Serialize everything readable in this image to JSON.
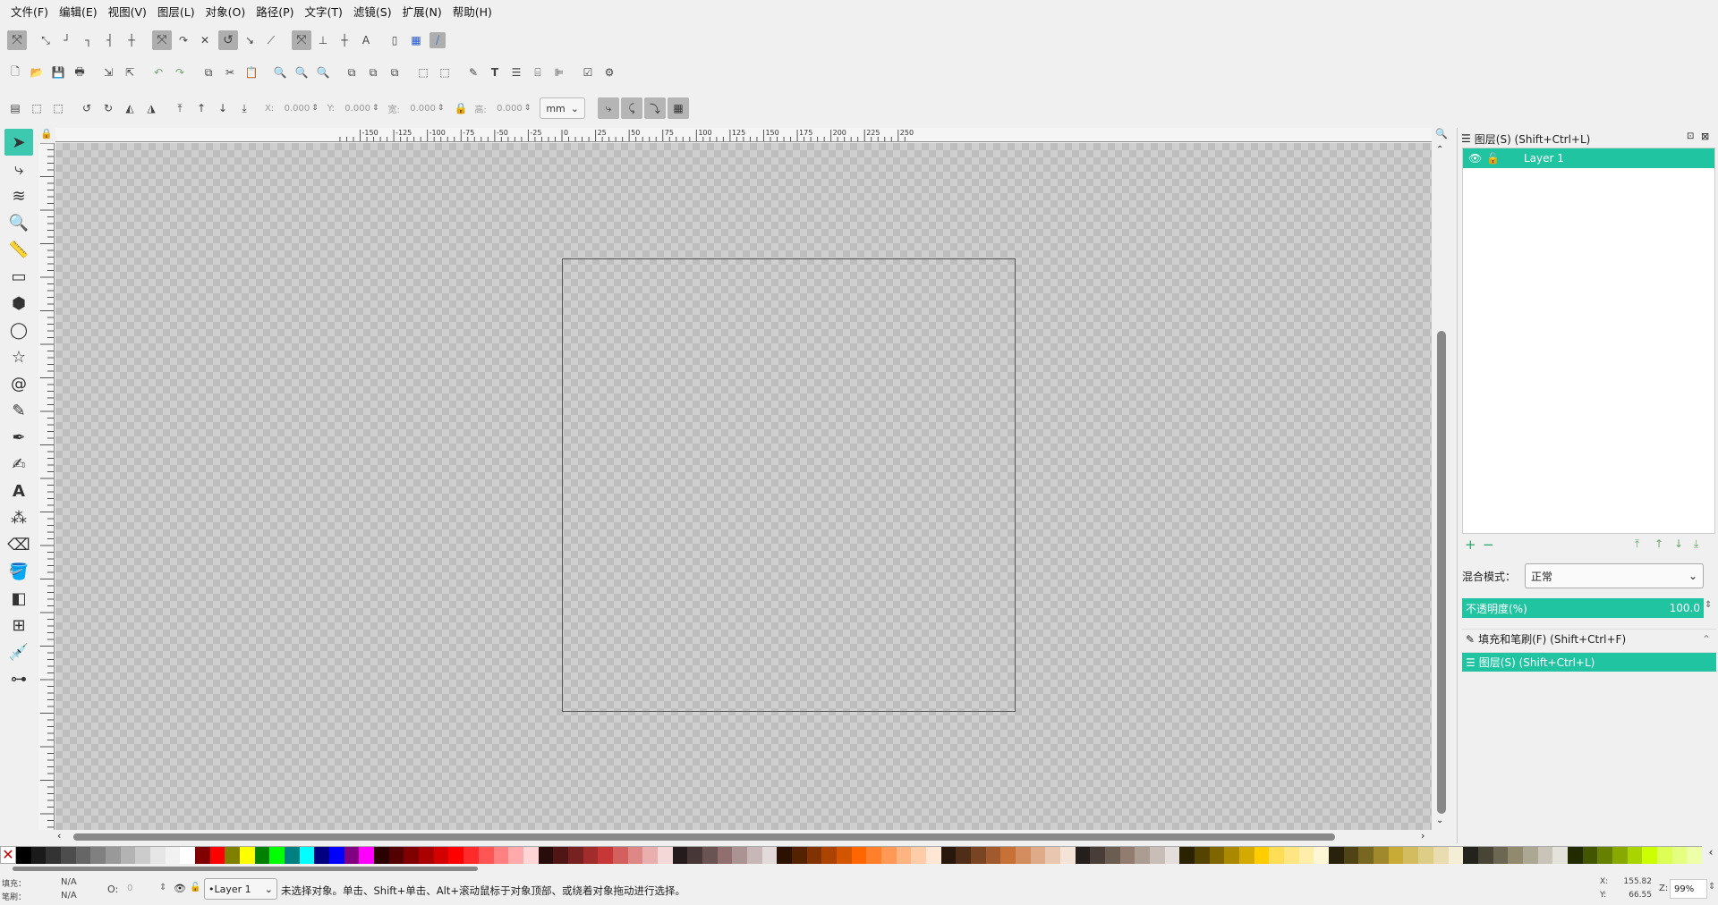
{
  "menu": [
    "文件(F)",
    "编辑(E)",
    "视图(V)",
    "图层(L)",
    "对象(O)",
    "路径(P)",
    "文字(T)",
    "滤镜(S)",
    "扩展(N)",
    "帮助(H)"
  ],
  "toolbar3": {
    "x_label": "X:",
    "x_value": "0.000",
    "y_label": "Y:",
    "y_value": "0.000",
    "w_label": "宽:",
    "w_value": "0.000",
    "h_label": "高:",
    "h_value": "0.000",
    "unit": "mm"
  },
  "hruler_ticks": [
    "-150",
    "-125",
    "-100",
    "-75",
    "-50",
    "-25",
    "0",
    "25",
    "50",
    "75",
    "100",
    "125",
    "150",
    "175",
    "200",
    "225",
    "250"
  ],
  "layers_panel": {
    "title": "图层(S) (Shift+Ctrl+L)",
    "layer_name": "Layer 1",
    "blend_label": "混合模式：",
    "blend_value": "正常",
    "opacity_label": "不透明度(%)",
    "opacity_value": "100.0",
    "dock_fill": "填充和笔刷(F) (Shift+Ctrl+F)",
    "dock_layers": "图层(S) (Shift+Ctrl+L)"
  },
  "status": {
    "fill_label": "填充：",
    "fill_value": "N/A",
    "stroke_label": "笔刷：",
    "stroke_value": "N/A",
    "o_label": "O:",
    "o_value": "0",
    "current_layer": "•Layer 1",
    "message": "未选择对象。单击、Shift+单击、Alt+滚动鼠标于对象顶部、或绕着对象拖动进行选择。",
    "cx_label": "X:",
    "cx_value": "155.82",
    "cy_label": "Y:",
    "cy_value": "66.55",
    "zoom_label": "Z:",
    "zoom_value": "99%"
  },
  "palette": [
    "#000000",
    "#1a1a1a",
    "#333333",
    "#4d4d4d",
    "#666666",
    "#808080",
    "#999999",
    "#b3b3b3",
    "#cccccc",
    "#e6e6e6",
    "#f2f2f2",
    "#ffffff",
    "#800000",
    "#ff0000",
    "#808000",
    "#ffff00",
    "#008000",
    "#00ff00",
    "#008080",
    "#00ffff",
    "#000080",
    "#0000ff",
    "#800080",
    "#ff00ff",
    "#2b0000",
    "#550000",
    "#800000",
    "#aa0000",
    "#d40000",
    "#ff0000",
    "#ff2a2a",
    "#ff5555",
    "#ff8080",
    "#ffaaaa",
    "#ffd5d5",
    "#280b0b",
    "#501616",
    "#782121",
    "#a02c2c",
    "#c83737",
    "#d35f5f",
    "#de8787",
    "#e9afaf",
    "#f4d7d7",
    "#241c1c",
    "#483737",
    "#6c5353",
    "#916f6f",
    "#ac9393",
    "#c8b7b7",
    "#e3dbdb",
    "#2b1100",
    "#552200",
    "#803300",
    "#aa4400",
    "#d45500",
    "#ff6600",
    "#ff7f2a",
    "#ff9955",
    "#ffb380",
    "#ffccaa",
    "#ffe6d5",
    "#28170b",
    "#502d16",
    "#784421",
    "#a05a2c",
    "#c87137",
    "#d38d5f",
    "#deaa87",
    "#e9c6af",
    "#f4e3d7",
    "#241f1c",
    "#483e37",
    "#6c5d53",
    "#917c6f",
    "#ac9d93",
    "#c8beb7",
    "#e3dedb",
    "#2b2200",
    "#554400",
    "#806600",
    "#aa8800",
    "#d4aa00",
    "#ffcc00",
    "#ffdd55",
    "#ffe680",
    "#ffeeaa",
    "#fff6d5",
    "#28220b",
    "#504416",
    "#786721",
    "#a0892c",
    "#c8ab37",
    "#d3bc5f",
    "#decd87",
    "#e9ddaf",
    "#f4eed7",
    "#24221c",
    "#484537",
    "#6c6753",
    "#918a6f",
    "#aca793",
    "#c8c4b7",
    "#e3e2db",
    "#222b00",
    "#445500",
    "#668000",
    "#88aa00",
    "#aad400",
    "#ccff00",
    "#ddff55",
    "#e5ff80",
    "#eeffaa"
  ]
}
